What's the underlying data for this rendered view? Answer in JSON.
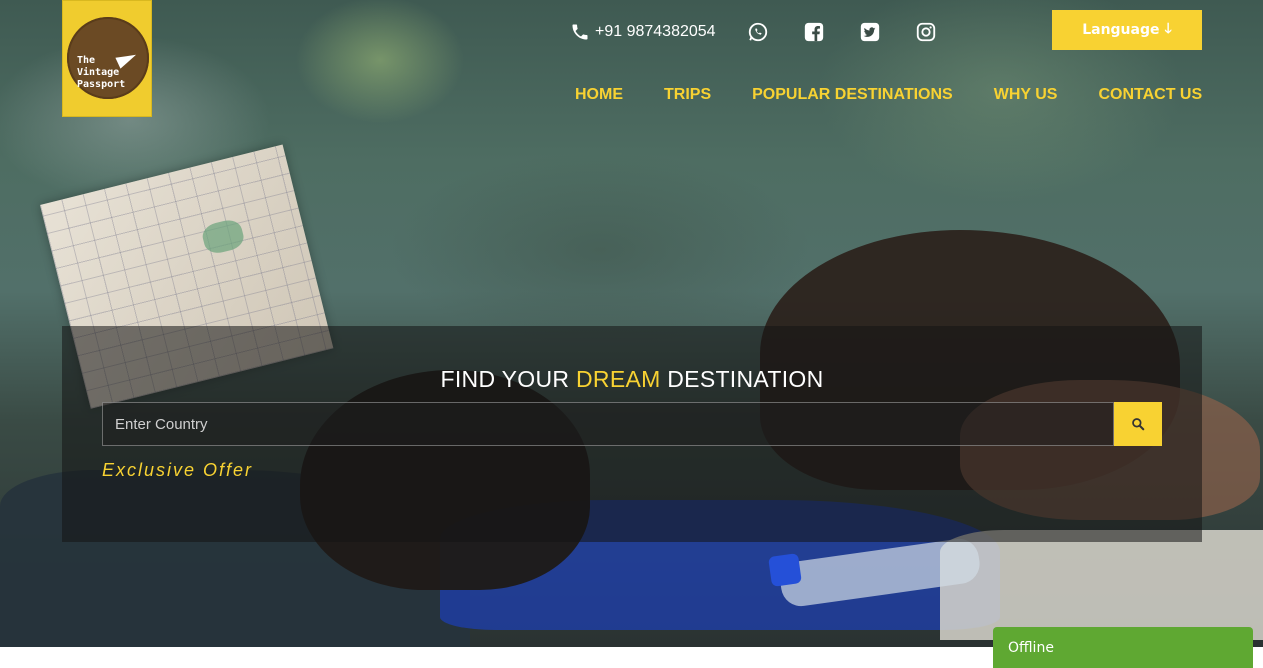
{
  "brand": {
    "logo_lines": [
      "The",
      "Vintage",
      "Passport"
    ]
  },
  "header": {
    "phone": "+91 9874382054",
    "social_icons": [
      "whatsapp-icon",
      "facebook-icon",
      "twitter-icon",
      "instagram-icon"
    ],
    "language_label": "Language",
    "language_arrow": "🡓"
  },
  "nav": {
    "items": [
      "HOME",
      "TRIPS",
      "POPULAR DESTINATIONS",
      "WHY US",
      "CONTACT US"
    ]
  },
  "hero": {
    "title_pre": "FIND YOUR",
    "title_highlight": "DREAM",
    "title_post": "DESTINATION",
    "search_placeholder": "Enter Country",
    "offer_text": "Exclusive Offer"
  },
  "chat": {
    "status": "Offline"
  },
  "colors": {
    "accent": "#f8d232",
    "chat_green": "#5fa832",
    "logo_brown": "#6b4a24"
  }
}
